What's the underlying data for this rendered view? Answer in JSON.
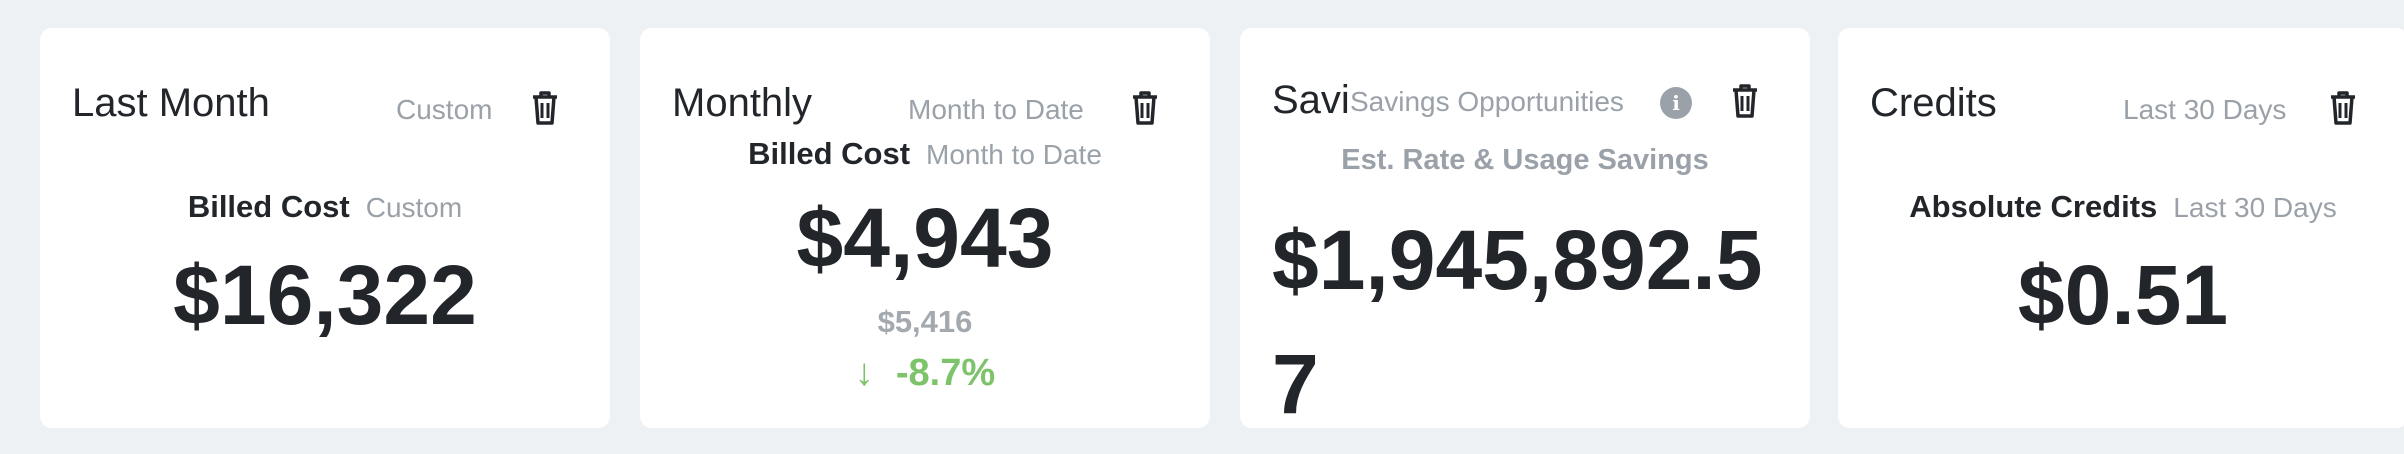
{
  "cards": [
    {
      "title": "Last Month",
      "range": "Custom",
      "metric_label": "Billed Cost",
      "metric_range": "Custom",
      "value": "$16,322"
    },
    {
      "title": "Monthly",
      "range": "Month to Date",
      "metric_label": "Billed Cost",
      "metric_range": "Month to Date",
      "value": "$4,943",
      "previous_value": "$5,416",
      "change_arrow": "↓",
      "change": "-8.7%"
    },
    {
      "title": "Savi",
      "heading": "Savings Opportunities",
      "info_icon": "i",
      "metric_label": "Est. Rate & Usage Savings",
      "value": "$1,945,892.57"
    },
    {
      "title": "Credits",
      "range": "Last 30 Days",
      "metric_label": "Absolute Credits",
      "metric_range": "Last 30 Days",
      "value": "$0.51"
    }
  ],
  "colors": {
    "background": "#eef1f3",
    "card": "#ffffff",
    "text": "#22262b",
    "muted": "#9aa1a8",
    "positive_change": "#7cc36a"
  }
}
